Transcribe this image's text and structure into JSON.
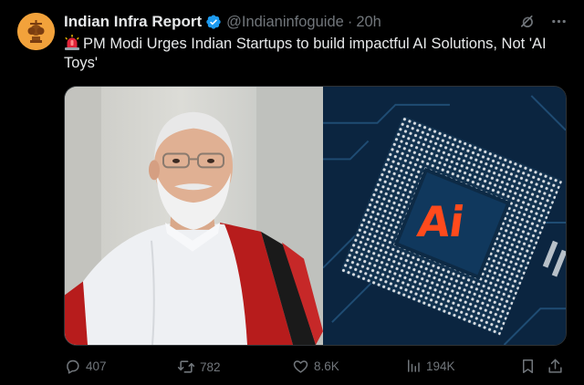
{
  "tweet": {
    "author_name": "Indian Infra Report",
    "handle": "@Indianinfoguide",
    "separator": "·",
    "time": "20h",
    "text": "PM Modi Urges Indian Startups to build impactful AI Solutions, Not 'AI Toys'",
    "text_prefix_icon": "siren-emoji",
    "media_text": "Ai",
    "stats": {
      "replies": "407",
      "reposts": "782",
      "likes": "8.6K",
      "views": "194K"
    }
  },
  "icons": {
    "verified": "verified-badge-icon",
    "grok": "grok-icon",
    "more": "more-icon",
    "reply": "reply-icon",
    "repost": "repost-icon",
    "like": "heart-icon",
    "views": "views-icon",
    "bookmark": "bookmark-icon",
    "share": "share-icon"
  },
  "colors": {
    "background": "#000000",
    "text_primary": "#e7e9ea",
    "text_secondary": "#71767b",
    "verified_blue": "#1d9bf0",
    "ai_orange": "#ff4a1c"
  }
}
